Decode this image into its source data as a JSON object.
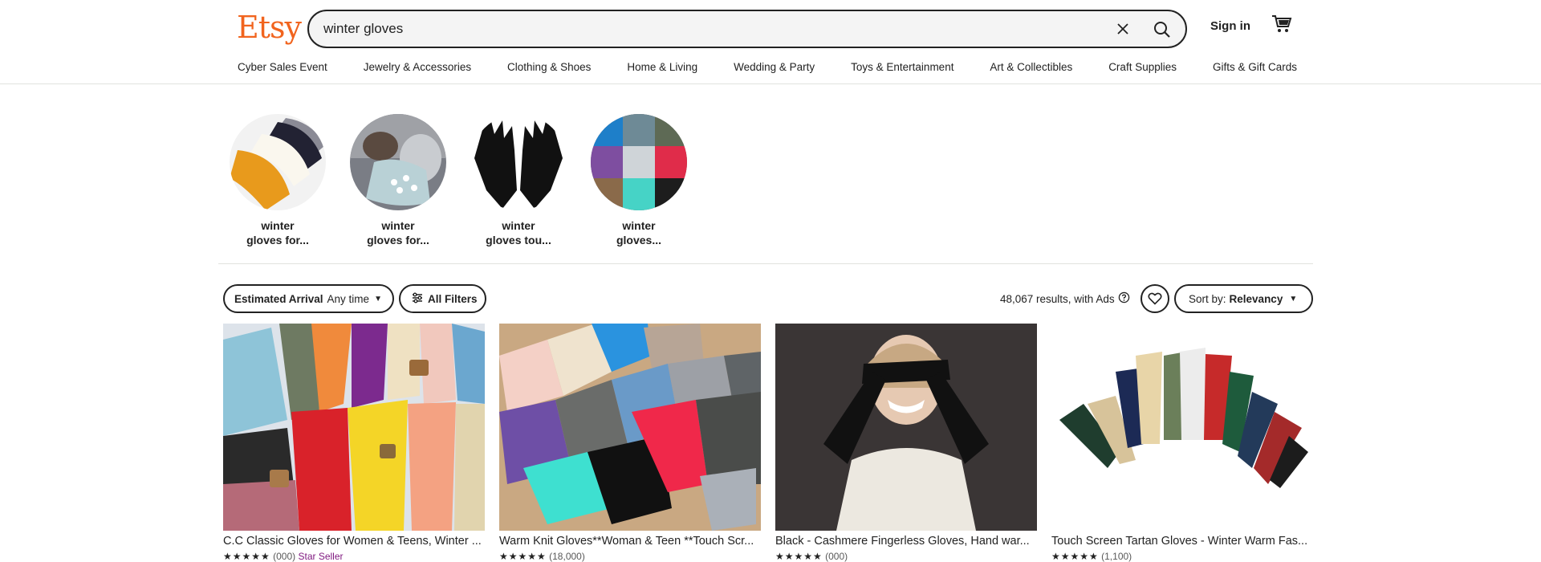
{
  "header": {
    "logo": "Etsy",
    "search_value": "winter gloves",
    "signin_label": "Sign in",
    "icons": [
      "clear-icon",
      "search-icon",
      "cart-icon"
    ]
  },
  "nav": [
    "Cyber Sales Event",
    "Jewelry & Accessories",
    "Clothing & Shoes",
    "Home & Living",
    "Wedding & Party",
    "Toys & Entertainment",
    "Art & Collectibles",
    "Craft Supplies",
    "Gifts & Gift Cards"
  ],
  "categories": [
    {
      "line1": "winter",
      "line2": "gloves for..."
    },
    {
      "line1": "winter",
      "line2": "gloves for..."
    },
    {
      "line1": "winter",
      "line2": "gloves tou..."
    },
    {
      "line1": "winter",
      "line2": "gloves..."
    }
  ],
  "filters": {
    "estimated_label": "Estimated Arrival",
    "estimated_value": "Any time",
    "all_filters_label": "All Filters",
    "results_text": "48,067 results, with Ads",
    "sort_prefix": "Sort by:",
    "sort_value": "Relevancy"
  },
  "products": [
    {
      "title": "C.C Classic Gloves for Women & Teens, Winter ...",
      "stars": "★★★★★",
      "count": "(000)",
      "badge": "Star Seller"
    },
    {
      "title": "Warm Knit Gloves**Woman & Teen **Touch Scr...",
      "stars": "★★★★★",
      "count": "(18,000)",
      "badge": ""
    },
    {
      "title": "Black - Cashmere Fingerless Gloves, Hand war...",
      "stars": "★★★★★",
      "count": "(000)",
      "badge": ""
    },
    {
      "title": "Touch Screen Tartan Gloves - Winter Warm Fas...",
      "stars": "★★★★★",
      "count": "(1,100)",
      "badge": ""
    }
  ],
  "colors": {
    "brand": "#f1641e",
    "text": "#222222",
    "star_seller": "#7f187f"
  }
}
